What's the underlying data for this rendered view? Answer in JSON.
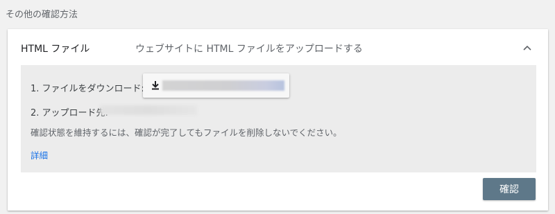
{
  "section": {
    "heading": "その他の確認方法"
  },
  "method": {
    "title": "HTML ファイル",
    "description": "ウェブサイトに HTML ファイルをアップロードする",
    "toggle_icon": "chevron-up-icon"
  },
  "panel": {
    "step1_label": "1. ファイルをダウンロード:",
    "download_icon": "download-icon",
    "step2_label": "2. アップロード先:",
    "note": "確認状態を維持するには、確認が完了してもファイルを削除しないでください。",
    "details_link": "詳細"
  },
  "actions": {
    "verify_label": "確認"
  },
  "colors": {
    "background": "#f1f1f1",
    "panel": "#ececec",
    "link": "#1a73e8",
    "primary_button": "#5e7889"
  }
}
